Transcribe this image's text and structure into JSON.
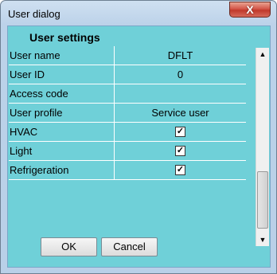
{
  "window": {
    "title": "User dialog",
    "close_glyph": "X"
  },
  "section": {
    "title": "User settings"
  },
  "rows": [
    {
      "label": "User name",
      "value": "DFLT",
      "type": "text"
    },
    {
      "label": "User ID",
      "value": "0",
      "type": "text"
    },
    {
      "label": "Access code",
      "value": "",
      "type": "text"
    },
    {
      "label": "User profile",
      "value": "Service user",
      "type": "text"
    },
    {
      "label": "HVAC",
      "checked": true,
      "type": "checkbox"
    },
    {
      "label": "Light",
      "checked": true,
      "type": "checkbox"
    },
    {
      "label": "Refrigeration",
      "checked": true,
      "type": "checkbox"
    }
  ],
  "checkmark": "✓",
  "scrollbar": {
    "up_glyph": "▲",
    "down_glyph": "▼"
  },
  "buttons": {
    "ok": "OK",
    "cancel": "Cancel"
  },
  "colors": {
    "panel": "#6fd0d8",
    "close": "#c0392b"
  }
}
